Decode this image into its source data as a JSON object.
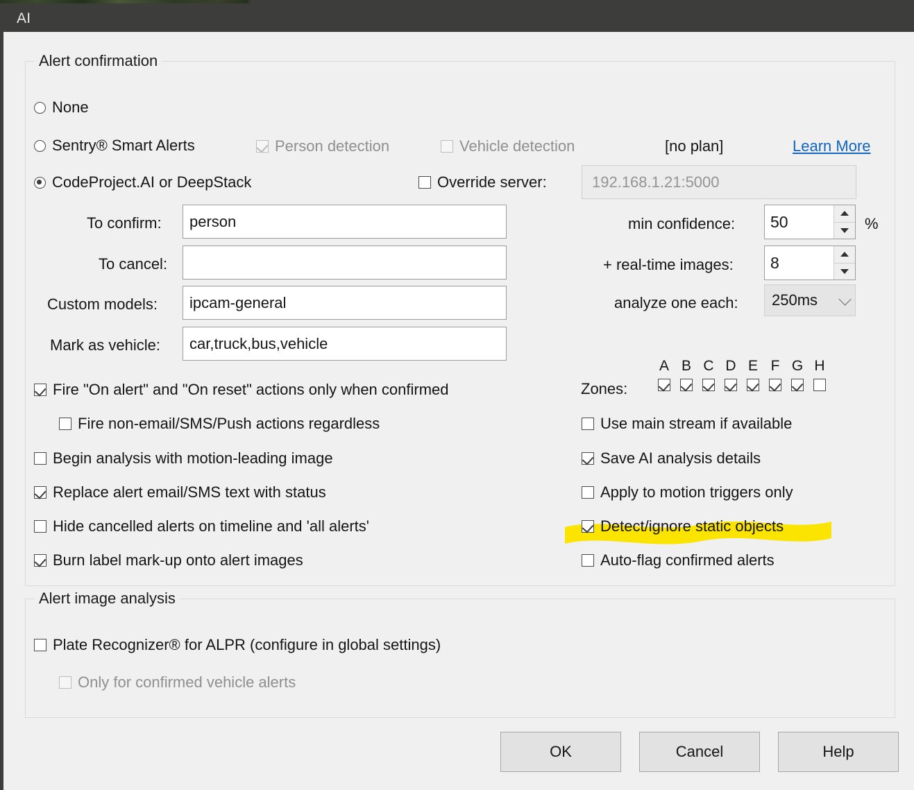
{
  "window": {
    "title": "AI"
  },
  "groups": {
    "alert_confirmation": {
      "title": "Alert confirmation"
    },
    "alert_image_analysis": {
      "title": "Alert image analysis"
    }
  },
  "confirmation_mode": {
    "options": [
      {
        "label": "None",
        "selected": false
      },
      {
        "label": "Sentry® Smart Alerts",
        "selected": false
      },
      {
        "label": "CodeProject.AI or DeepStack",
        "selected": true
      }
    ]
  },
  "sentry": {
    "person_detection_label": "Person detection",
    "person_detection_checked": true,
    "vehicle_detection_label": "Vehicle detection",
    "vehicle_detection_checked": false,
    "plan_status": "[no plan]",
    "learn_more": "Learn More",
    "link_color": "#1065c0"
  },
  "override_server": {
    "label": "Override server:",
    "checked": false,
    "value": "192.168.1.21:5000",
    "disabled": true
  },
  "fields": [
    {
      "label": "To confirm:",
      "value": "person"
    },
    {
      "label": "To cancel:",
      "value": ""
    },
    {
      "label": "Custom models:",
      "value": "ipcam-general"
    },
    {
      "label": "Mark as vehicle:",
      "value": "car,truck,bus,vehicle"
    }
  ],
  "numeric": {
    "min_confidence": {
      "label": "min confidence:",
      "value": "50",
      "unit": "%"
    },
    "realtime_images": {
      "label": "+ real-time images:",
      "value": "8"
    },
    "analyze_one_each": {
      "label": "analyze one each:",
      "value": "250ms"
    }
  },
  "zones": {
    "label": "Zones:",
    "letters": [
      "A",
      "B",
      "C",
      "D",
      "E",
      "F",
      "G",
      "H"
    ],
    "checked": [
      true,
      true,
      true,
      true,
      true,
      true,
      true,
      false
    ]
  },
  "left_options": [
    {
      "label": "Fire \"On alert\" and \"On reset\" actions only when confirmed",
      "checked": true,
      "indent": false
    },
    {
      "label": "Fire non-email/SMS/Push actions regardless",
      "checked": false,
      "indent": true
    },
    {
      "label": "Begin analysis with motion-leading image",
      "checked": false,
      "indent": false
    },
    {
      "label": "Replace alert email/SMS text with status",
      "checked": true,
      "indent": false
    },
    {
      "label": "Hide cancelled alerts on timeline and  'all alerts'",
      "checked": false,
      "indent": false
    },
    {
      "label": "Burn label mark-up onto alert images",
      "checked": true,
      "indent": false
    }
  ],
  "right_options": [
    {
      "label": "Use main stream if available",
      "checked": false,
      "highlighted": false
    },
    {
      "label": "Save AI analysis details",
      "checked": true,
      "highlighted": false
    },
    {
      "label": "Apply to motion triggers only",
      "checked": false,
      "highlighted": false
    },
    {
      "label": "Detect/ignore static objects",
      "checked": true,
      "highlighted": true
    },
    {
      "label": "Auto-flag confirmed alerts",
      "checked": false,
      "highlighted": false
    }
  ],
  "image_analysis": [
    {
      "label": "Plate Recognizer® for ALPR (configure in global settings)",
      "checked": false,
      "disabled": false,
      "indent": false
    },
    {
      "label": "Only for confirmed vehicle alerts",
      "checked": false,
      "disabled": true,
      "indent": true
    }
  ],
  "buttons": [
    {
      "label": "OK"
    },
    {
      "label": "Cancel"
    },
    {
      "label": "Help"
    }
  ],
  "highlight_color": "#FBE500"
}
